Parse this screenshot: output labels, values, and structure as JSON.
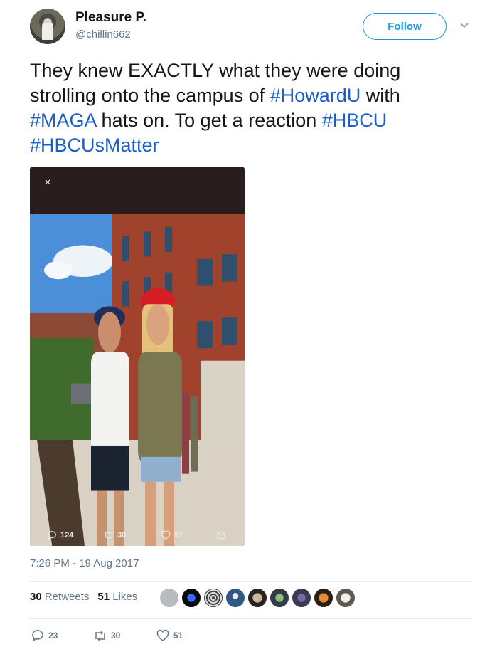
{
  "user": {
    "display_name": "Pleasure P.",
    "handle": "@chillin662",
    "follow_label": "Follow"
  },
  "tweet": {
    "text_part1": "They knew EXACTLY what they were doing strolling onto the campus of ",
    "hashtag1": "#HowardU",
    "text_part2": " with ",
    "hashtag2": "#MAGA",
    "text_part3": " hats on. To get a reaction ",
    "hashtag3": "#HBCU",
    "text_part4": " ",
    "hashtag4": "#HBCUsMatter"
  },
  "media": {
    "close_symbol": "×",
    "replies": "124",
    "retweets": "30",
    "likes": "57"
  },
  "timestamp": "7:26 PM - 19 Aug 2017",
  "stats": {
    "retweets_count": "30",
    "retweets_label": "Retweets",
    "likes_count": "51",
    "likes_label": "Likes"
  },
  "actions": {
    "replies": "23",
    "retweets": "30",
    "likes": "51"
  },
  "icons": {
    "reply": "reply-icon",
    "retweet": "retweet-icon",
    "like": "heart-icon",
    "dm": "envelope-icon",
    "caret": "chevron-down-icon"
  },
  "colors": {
    "link": "#1b5fcc",
    "follow": "#1b95e0",
    "media_bg": "#2a1d1d",
    "muted": "#657786"
  }
}
